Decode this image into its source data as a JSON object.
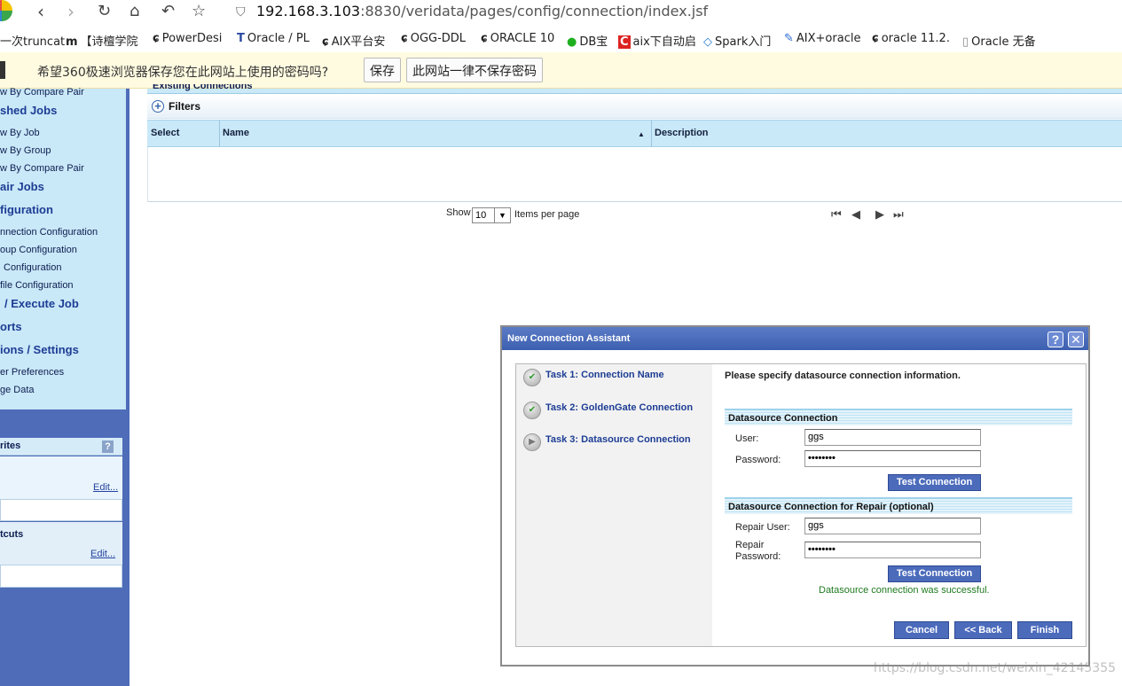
{
  "browser": {
    "url_host": "192.168.3.103",
    "url_path": ":8830/veridata/pages/config/connection/index.jsf",
    "bookmarks": [
      "一次truncat",
      "【诗檀学院",
      "PowerDesi",
      "Oracle / PL",
      "AIX平台安",
      "OGG-DDL",
      "ORACLE 10",
      "DB宝",
      "aix下自动启",
      "Spark入门",
      "AIX+oracle",
      "oracle 11.2.",
      "Oracle 无备"
    ],
    "password_prompt": {
      "message": "希望360极速浏览器保存您在此网站上使用的密码吗?",
      "save_label": "保存",
      "never_label": "此网站一律不保存密码"
    }
  },
  "sidebar": {
    "items": [
      {
        "text": "w By Compare Pair",
        "type": "item"
      },
      {
        "text": "shed Jobs",
        "type": "head"
      },
      {
        "text": "w By Job",
        "type": "item"
      },
      {
        "text": "w By Group",
        "type": "item"
      },
      {
        "text": "w By Compare Pair",
        "type": "item"
      },
      {
        "text": "air Jobs",
        "type": "head"
      },
      {
        "text": "figuration",
        "type": "head"
      },
      {
        "text": "nnection Configuration",
        "type": "item"
      },
      {
        "text": "oup Configuration",
        "type": "item"
      },
      {
        "text": "Configuration",
        "type": "item"
      },
      {
        "text": "file Configuration",
        "type": "item"
      },
      {
        "text": "/ Execute Job",
        "type": "head"
      },
      {
        "text": "orts",
        "type": "head"
      },
      {
        "text": "ions / Settings",
        "type": "head"
      },
      {
        "text": "er Preferences",
        "type": "item"
      },
      {
        "text": "ge Data",
        "type": "item"
      }
    ],
    "favorites_title": "rites",
    "favorites_help": "?",
    "favorites_edit": "Edit...",
    "shortcuts_title": "tcuts",
    "shortcuts_edit": "Edit..."
  },
  "grid": {
    "title": "Existing Connections",
    "filters_label": "Filters",
    "columns": [
      "Select",
      "Name",
      "Description"
    ],
    "sort_indicator": "▲",
    "pager": {
      "show_label": "Show",
      "per_page_value": "10",
      "items_label": "Items per page"
    }
  },
  "dialog": {
    "title": "New Connection Assistant",
    "help": "?",
    "steps": [
      {
        "label": "Task 1: Connection Name",
        "status": "done"
      },
      {
        "label": "Task 2: GoldenGate Connection",
        "status": "done"
      },
      {
        "label": "Task 3: Datasource Connection",
        "status": "current"
      }
    ],
    "intro": "Please specify datasource connection information.",
    "section1_title": "Datasource Connection",
    "user_label": "User:",
    "user_value": "ggs",
    "password_label": "Password:",
    "password_value": "••••••••",
    "test_label": "Test Connection",
    "section2_title": "Datasource Connection for Repair (optional)",
    "repair_user_label": "Repair User:",
    "repair_user_value": "ggs",
    "repair_password_label_1": "Repair",
    "repair_password_label_2": "Password:",
    "repair_password_value": "••••••••",
    "test2_label": "Test Connection",
    "success_message": "Datasource connection was successful.",
    "cancel_label": "Cancel",
    "back_label": "<< Back",
    "finish_label": "Finish"
  },
  "watermark": "https://blog.csdn.net/weixin_42145355"
}
